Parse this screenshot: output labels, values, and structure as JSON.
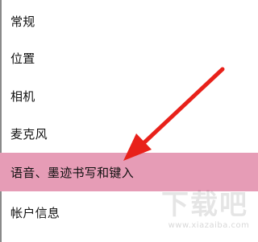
{
  "menu": {
    "items": [
      {
        "label": "常规"
      },
      {
        "label": "位置"
      },
      {
        "label": "相机"
      },
      {
        "label": "麦克风"
      },
      {
        "label": "语音、墨迹书写和键入",
        "selected": true
      },
      {
        "label": "帐户信息"
      }
    ]
  },
  "watermark": {
    "mark": "下载吧",
    "url": "www.xiazaiba.com"
  },
  "colors": {
    "selected_bg": "#e69cb6",
    "arrow": "#e8211a",
    "text": "#111111"
  },
  "icons": {
    "annotation": "arrow-annotation"
  }
}
